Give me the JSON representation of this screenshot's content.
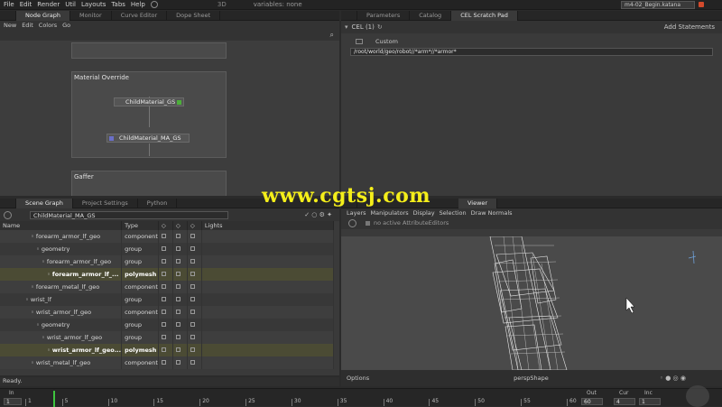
{
  "menubar": {
    "items": [
      "File",
      "Edit",
      "Render",
      "Util",
      "Layouts",
      "Tabs",
      "Help"
    ],
    "variables": "variables: none",
    "project": "m4-02_Begin.katana",
    "res": "3D"
  },
  "nodegraph": {
    "tabs": [
      "Node Graph",
      "Monitor",
      "Curve Editor",
      "Dope Sheet"
    ],
    "menu": [
      "New",
      "Edit",
      "Colors",
      "Go"
    ],
    "box_title": "Material Override",
    "nodes": [
      "ChildMaterial_GS",
      "ChildMaterial_MA_GS"
    ],
    "gaffer": "Gaffer"
  },
  "cel": {
    "tabs": [
      "Parameters",
      "Catalog",
      "CEL Scratch Pad"
    ],
    "header": "CEL (1)",
    "add_statements": "Add Statements",
    "custom": "Custom",
    "expression": "/root/world/geo/robot//*arm*//*armor*"
  },
  "scenegraph": {
    "tabs": [
      "Scene Graph",
      "Project Settings",
      "Python"
    ],
    "field": "ChildMaterial_MA_GS",
    "headers": [
      "Name",
      "Type",
      "",
      "",
      "",
      "Lights"
    ],
    "rows": [
      {
        "name": "forearm_armor_lf_geo",
        "type": "component",
        "sel": false,
        "indent": 34
      },
      {
        "name": "geometry",
        "type": "group",
        "sel": false,
        "indent": 40
      },
      {
        "name": "forearm_armor_lf_geo",
        "type": "group",
        "sel": false,
        "indent": 46
      },
      {
        "name": "forearm_armor_lf_...",
        "type": "polymesh",
        "sel": true,
        "indent": 52
      },
      {
        "name": "forearm_metal_lf_geo",
        "type": "component",
        "sel": false,
        "indent": 34
      },
      {
        "name": "wrist_lf",
        "type": "group",
        "sel": false,
        "indent": 28
      },
      {
        "name": "wrist_armor_lf_geo",
        "type": "component",
        "sel": false,
        "indent": 34
      },
      {
        "name": "geometry",
        "type": "group",
        "sel": false,
        "indent": 40
      },
      {
        "name": "wrist_armor_lf_geo",
        "type": "group",
        "sel": false,
        "indent": 46
      },
      {
        "name": "wrist_armor_lf_geo...",
        "type": "polymesh",
        "sel": true,
        "indent": 52
      },
      {
        "name": "wrist_metal_lf_geo",
        "type": "component",
        "sel": false,
        "indent": 34
      }
    ],
    "status": "Ready."
  },
  "viewer": {
    "tab": "Viewer",
    "menu": [
      "Layers",
      "Manipulators",
      "Display",
      "Selection",
      "Draw Normals"
    ],
    "no_editors": "no active AttributeEditors",
    "options": "Options",
    "camera": "perspShape"
  },
  "timeline": {
    "in_label": "In",
    "in_value": "1",
    "out_label": "Out",
    "out_value": "60",
    "cur_label": "Cur",
    "cur_value": "4",
    "inc_label": "Inc",
    "inc_value": "1",
    "ticks": [
      "1",
      "5",
      "10",
      "15",
      "20",
      "25",
      "30",
      "35",
      "40",
      "45",
      "50",
      "55",
      "60"
    ]
  },
  "watermark": "www.cgtsj.com"
}
